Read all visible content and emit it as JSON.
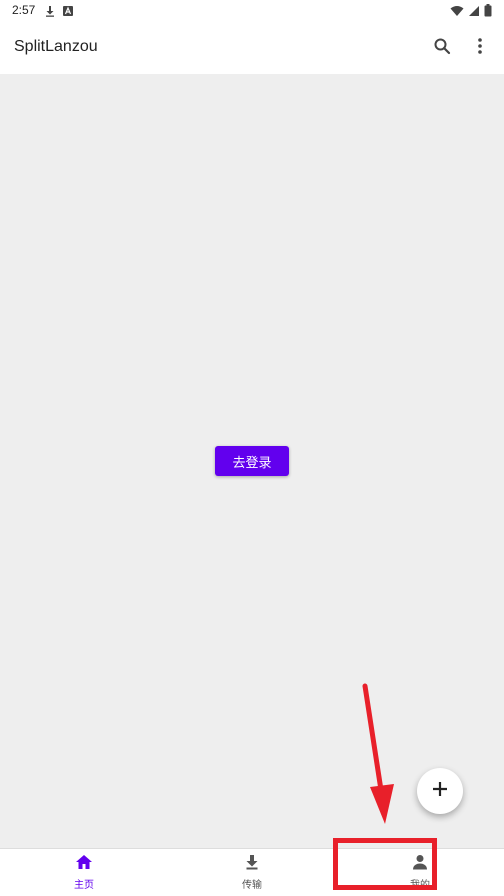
{
  "status_bar": {
    "time": "2:57",
    "left_icons": [
      "download-icon",
      "a-icon"
    ],
    "right_icons": [
      "wifi-icon",
      "signal-icon",
      "battery-icon"
    ]
  },
  "app_bar": {
    "title": "SplitLanzou",
    "actions": [
      "search-icon",
      "more-vert-icon"
    ]
  },
  "main": {
    "login_button_label": "去登录"
  },
  "fab": {
    "icon": "plus-icon"
  },
  "bottom_nav": {
    "items": [
      {
        "label": "主页",
        "icon": "home-icon",
        "active": true
      },
      {
        "label": "传输",
        "icon": "download-icon",
        "active": false
      },
      {
        "label": "我的",
        "icon": "person-icon",
        "active": false
      }
    ]
  },
  "colors": {
    "accent": "#6200ee",
    "annotation": "#e8202a",
    "background": "#eeeeee"
  }
}
